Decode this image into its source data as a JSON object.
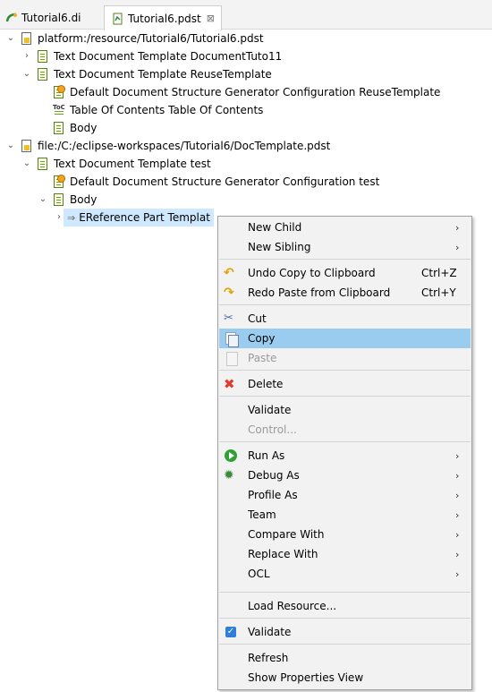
{
  "tabs": [
    {
      "label": "Tutorial6.di"
    },
    {
      "label": "Tutorial6.pdst",
      "close": "⊠"
    }
  ],
  "tree": {
    "rows": [
      {
        "label": "platform:/resource/Tutorial6/Tutorial6.pdst",
        "expander": "expanded",
        "icon": "pdst-file-icon"
      },
      {
        "label": "Text Document Template DocumentTuto11",
        "expander": "collapsed",
        "icon": "document-template-icon"
      },
      {
        "label": "Text Document Template ReuseTemplate",
        "expander": "expanded",
        "icon": "document-template-icon"
      },
      {
        "label": "Default Document Structure Generator Configuration ReuseTemplate",
        "expander": "none",
        "icon": "generator-config-icon"
      },
      {
        "label": "Table Of Contents Table Of Contents",
        "expander": "none",
        "icon": "table-of-contents-icon"
      },
      {
        "label": "Body",
        "expander": "none",
        "icon": "body-icon"
      },
      {
        "label": "file:/C:/eclipse-workspaces/Tutorial6/DocTemplate.pdst",
        "expander": "expanded",
        "icon": "pdst-file-icon"
      },
      {
        "label": "Text Document Template test",
        "expander": "expanded",
        "icon": "document-template-icon"
      },
      {
        "label": "Default Document Structure Generator Configuration test",
        "expander": "none",
        "icon": "generator-config-icon"
      },
      {
        "label": "Body",
        "expander": "expanded",
        "icon": "body-icon"
      },
      {
        "label": "EReference Part Templat",
        "expander": "collapsed",
        "icon": "ereference-part-icon",
        "selected": true
      }
    ]
  },
  "context_menu": {
    "new_child": "New Child",
    "new_sibling": "New Sibling",
    "undo": "Undo Copy to Clipboard",
    "undo_accel": "Ctrl+Z",
    "redo": "Redo Paste from Clipboard",
    "redo_accel": "Ctrl+Y",
    "cut": "Cut",
    "copy": "Copy",
    "paste": "Paste",
    "delete": "Delete",
    "validate": "Validate",
    "control": "Control...",
    "run_as": "Run As",
    "debug_as": "Debug As",
    "profile_as": "Profile As",
    "team": "Team",
    "compare_with": "Compare With",
    "replace_with": "Replace With",
    "ocl": "OCL",
    "load_resource": "Load Resource...",
    "validate_toggle": "Validate",
    "refresh": "Refresh",
    "show_properties": "Show Properties View",
    "submenu_arrow": "›",
    "highlighted_item": "Copy"
  },
  "colors": {
    "selection": "#cde8ff",
    "menu_highlight": "#99ccee",
    "menu_background": "#f2f2f2"
  }
}
